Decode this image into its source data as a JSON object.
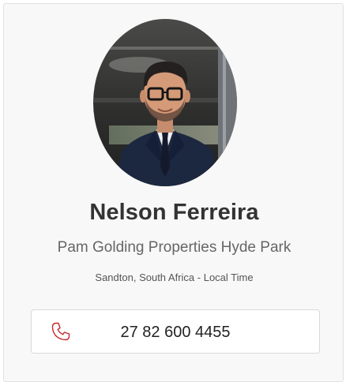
{
  "agent": {
    "name": "Nelson Ferreira",
    "agency": "Pam Golding Properties Hyde Park",
    "location": "Sandton, South Africa - Local Time",
    "phone": "27 82 600 4455"
  },
  "icons": {
    "phone": "phone-icon",
    "photo": "agent-avatar"
  },
  "colors": {
    "card_background": "#f8f8f8",
    "name_text": "#333333",
    "phone_icon": "#c62828"
  }
}
